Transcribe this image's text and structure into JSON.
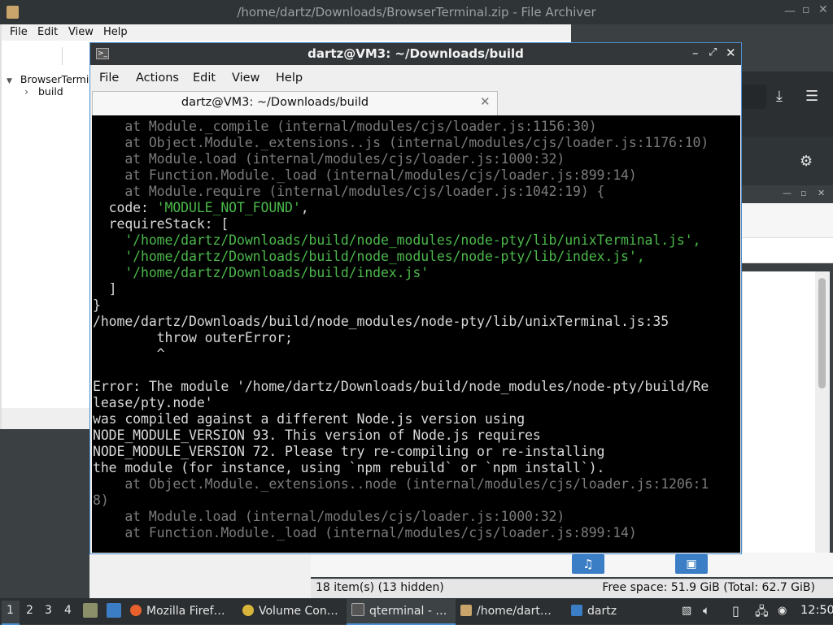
{
  "file_archiver": {
    "title": "/home/dartz/Downloads/BrowserTerminal.zip - File Archiver",
    "menu": [
      "File",
      "Edit",
      "View",
      "Help"
    ],
    "tree": [
      {
        "label": "BrowserTerminal",
        "expander": "▼"
      },
      {
        "label": "build",
        "expander": "›"
      }
    ]
  },
  "terminal": {
    "window_title": "dartz@VM3: ~/Downloads/build",
    "menu": [
      "File",
      "Actions",
      "Edit",
      "View",
      "Help"
    ],
    "tab_label": "dartz@VM3: ~/Downloads/build",
    "lines": [
      {
        "text": "    at Module._compile (internal/modules/cjs/loader.js:1156:30)",
        "style": "gr"
      },
      {
        "text": "    at Object.Module._extensions..js (internal/modules/cjs/loader.js:1176:10)",
        "style": "gr"
      },
      {
        "text": "    at Module.load (internal/modules/cjs/loader.js:1000:32)",
        "style": "gr"
      },
      {
        "text": "    at Function.Module._load (internal/modules/cjs/loader.js:899:14)",
        "style": "gr"
      },
      {
        "text": "    at Module.require (internal/modules/cjs/loader.js:1042:19) {",
        "style": "gr"
      },
      {
        "text": "  code: 'MODULE_NOT_FOUND',",
        "style": "mixed_code"
      },
      {
        "text": "  requireStack: [",
        "style": "wh"
      },
      {
        "text": "    '/home/dartz/Downloads/build/node_modules/node-pty/lib/unixTerminal.js',",
        "style": "gn"
      },
      {
        "text": "    '/home/dartz/Downloads/build/node_modules/node-pty/lib/index.js',",
        "style": "gn"
      },
      {
        "text": "    '/home/dartz/Downloads/build/index.js'",
        "style": "gn"
      },
      {
        "text": "  ]",
        "style": "wh"
      },
      {
        "text": "}",
        "style": "wh"
      },
      {
        "text": "/home/dartz/Downloads/build/node_modules/node-pty/lib/unixTerminal.js:35",
        "style": "wh"
      },
      {
        "text": "        throw outerError;",
        "style": "wh"
      },
      {
        "text": "        ^",
        "style": "wh"
      },
      {
        "text": "",
        "style": "wh"
      },
      {
        "text": "Error: The module '/home/dartz/Downloads/build/node_modules/node-pty/build/Re",
        "style": "wh"
      },
      {
        "text": "lease/pty.node'",
        "style": "wh"
      },
      {
        "text": "was compiled against a different Node.js version using",
        "style": "wh"
      },
      {
        "text": "NODE_MODULE_VERSION 93. This version of Node.js requires",
        "style": "wh"
      },
      {
        "text": "NODE_MODULE_VERSION 72. Please try re-compiling or re-installing",
        "style": "wh"
      },
      {
        "text": "the module (for instance, using `npm rebuild` or `npm install`).",
        "style": "wh"
      },
      {
        "text": "    at Object.Module._extensions..node (internal/modules/cjs/loader.js:1206:1",
        "style": "gr"
      },
      {
        "text": "8)",
        "style": "gr"
      },
      {
        "text": "    at Module.load (internal/modules/cjs/loader.js:1000:32)",
        "style": "gr"
      },
      {
        "text": "    at Function.Module._load (internal/modules/cjs/loader.js:899:14)",
        "style": "gr"
      }
    ],
    "code_parts": {
      "prefix": "  code: ",
      "value": "'MODULE_NOT_FOUND'",
      "suffix": ","
    }
  },
  "file_manager": {
    "status_items": "18 item(s) (13 hidden)",
    "status_free": "Free space: 51.9 GiB (Total: 62.7 GiB)"
  },
  "taskbar": {
    "workspaces": [
      "1",
      "2",
      "3",
      "4"
    ],
    "tasks": [
      {
        "label": "Mozilla Firef…",
        "icon": "firefox-icon",
        "color": "#e8612c"
      },
      {
        "label": "Volume Con…",
        "icon": "volume-control-icon",
        "color": "#d8b43a"
      },
      {
        "label": "qterminal - …",
        "icon": "terminal-icon",
        "color": "#888888"
      },
      {
        "label": "/home/dart…",
        "icon": "archive-icon",
        "color": "#caa56b"
      },
      {
        "label": "dartz",
        "icon": "folder-icon",
        "color": "#3b7ec5"
      }
    ],
    "clock": "12:50"
  },
  "colors": {
    "accent": "#4d8fd0",
    "terminal_bg": "#000000",
    "terminal_green": "#4bb84b",
    "terminal_gray": "#7b7b7b"
  }
}
